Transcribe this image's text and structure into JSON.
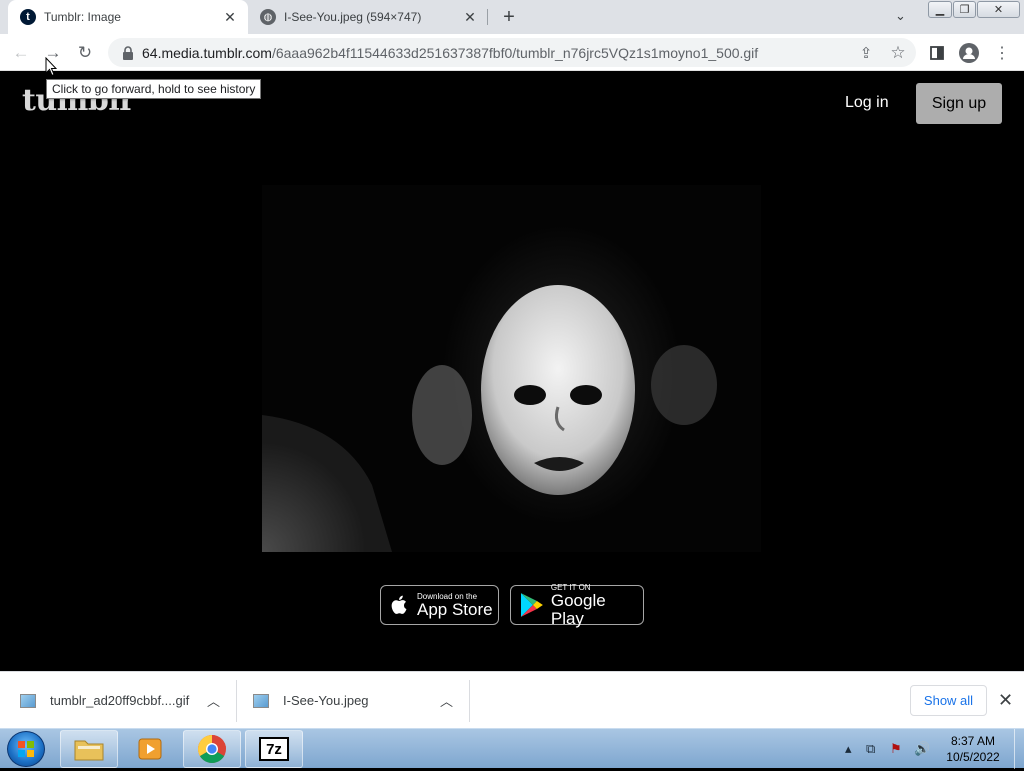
{
  "tabs": [
    {
      "title": "Tumblr: Image",
      "favicon": "tumblr-icon",
      "active": true
    },
    {
      "title": "I-See-You.jpeg (594×747)",
      "favicon": "globe-icon",
      "active": false
    }
  ],
  "toolbar": {
    "url_host": "64.media.tumblr.com",
    "url_path": "/6aaa962b4f11544633d251637387fbf0/tumblr_n76jrc5VQz1s1moyno1_500.gif"
  },
  "tooltip": "Click to go forward, hold to see history",
  "page": {
    "logo": "tumblr",
    "login_label": "Log in",
    "signup_label": "Sign up",
    "app_store": {
      "small": "Download on the",
      "big": "App Store"
    },
    "google_play": {
      "small": "GET IT ON",
      "big": "Google Play"
    }
  },
  "downloads": {
    "items": [
      {
        "name": "tumblr_ad20ff9cbbf....gif"
      },
      {
        "name": "I-See-You.jpeg"
      }
    ],
    "show_all_label": "Show all"
  },
  "taskbar": {
    "time": "8:37 AM",
    "date": "10/5/2022"
  },
  "colors": {
    "tab_strip": "#dee1e6",
    "signup_bg": "#adadad",
    "link_blue": "#1a73e8"
  }
}
